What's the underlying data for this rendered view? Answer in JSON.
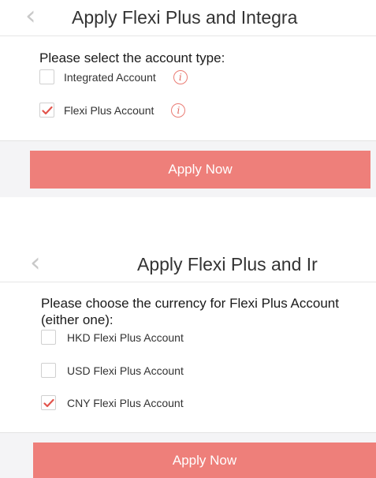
{
  "screen1": {
    "back_icon": "chevron-left-icon",
    "title": "Apply Flexi Plus and Integra",
    "prompt": "Please select the account type:",
    "options": [
      {
        "label": "Integrated Account",
        "checked": false,
        "info_icon": "info-icon"
      },
      {
        "label": "Flexi Plus Account",
        "checked": true,
        "info_icon": "info-icon"
      }
    ],
    "info_glyph": "i",
    "apply_label": "Apply Now"
  },
  "screen2": {
    "back_icon": "chevron-left-icon",
    "title": "Apply Flexi Plus and Ir",
    "prompt_line1": "Please choose the currency for Flexi Plus Account",
    "prompt_line2": "(either one):",
    "options": [
      {
        "label": "HKD Flexi Plus Account",
        "checked": false
      },
      {
        "label": "USD Flexi Plus Account",
        "checked": false
      },
      {
        "label": "CNY Flexi Plus Account",
        "checked": true
      }
    ],
    "apply_label": "Apply Now"
  },
  "colors": {
    "accent": "#ee7f7a",
    "checkmark": "#e2544c",
    "info": "#ea7c74",
    "back_chevron": "#c9c9c9"
  }
}
